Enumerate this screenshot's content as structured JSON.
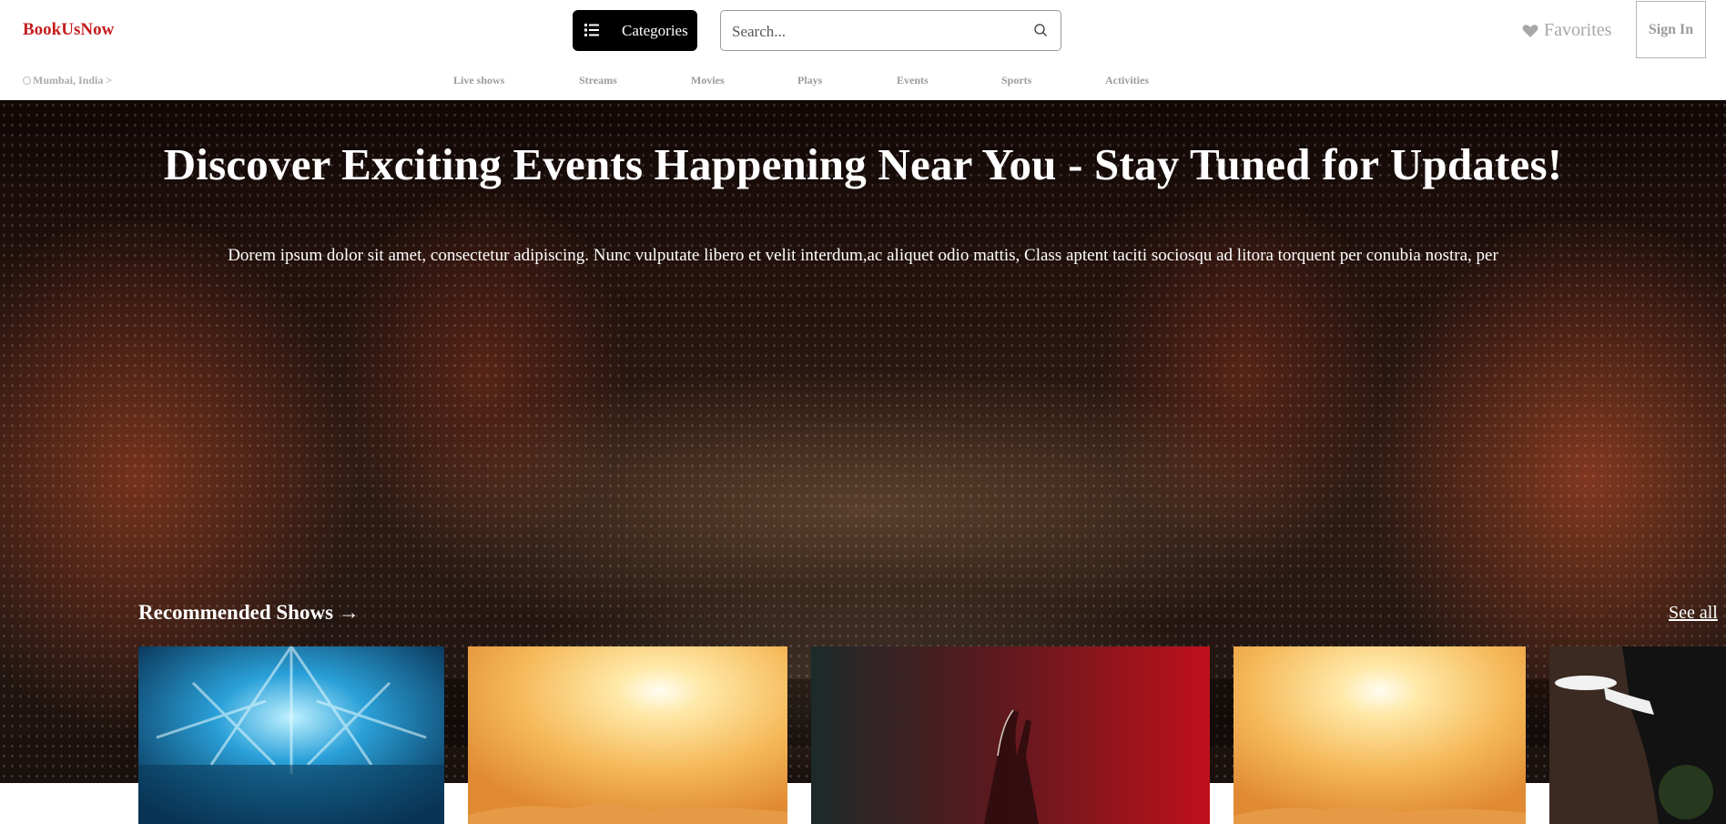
{
  "header": {
    "logo": "BookUsNow",
    "categories_label": "Categories",
    "search_placeholder": "Search...",
    "favorites_label": "Favorites",
    "signin_label": "Sign In"
  },
  "location": "Mumbai, India >",
  "nav": [
    "Live shows",
    "Streams",
    "Movies",
    "Plays",
    "Events",
    "Sports",
    "Activities"
  ],
  "hero": {
    "title": "Discover Exciting Events Happening Near You - Stay Tuned for Updates!",
    "subtitle": "Dorem ipsum dolor sit amet, consectetur adipiscing. Nunc vulputate libero et velit interdum,ac aliquet odio mattis, Class aptent taciti sociosqu ad litora torquent per conubia nostra, per"
  },
  "recommended": {
    "title": "Recommended Shows →",
    "see_all": "See all",
    "cards": [
      {
        "image": "concert-stage-lights"
      },
      {
        "image": "desert-sunset"
      },
      {
        "image": "hands-red-smoke"
      },
      {
        "image": "desert-sunset"
      },
      {
        "image": "waiter-serving-plate"
      }
    ]
  },
  "colors": {
    "logo": "#c41e1e",
    "categories_bg": "#000000",
    "nav_text": "#9b9b9b"
  }
}
